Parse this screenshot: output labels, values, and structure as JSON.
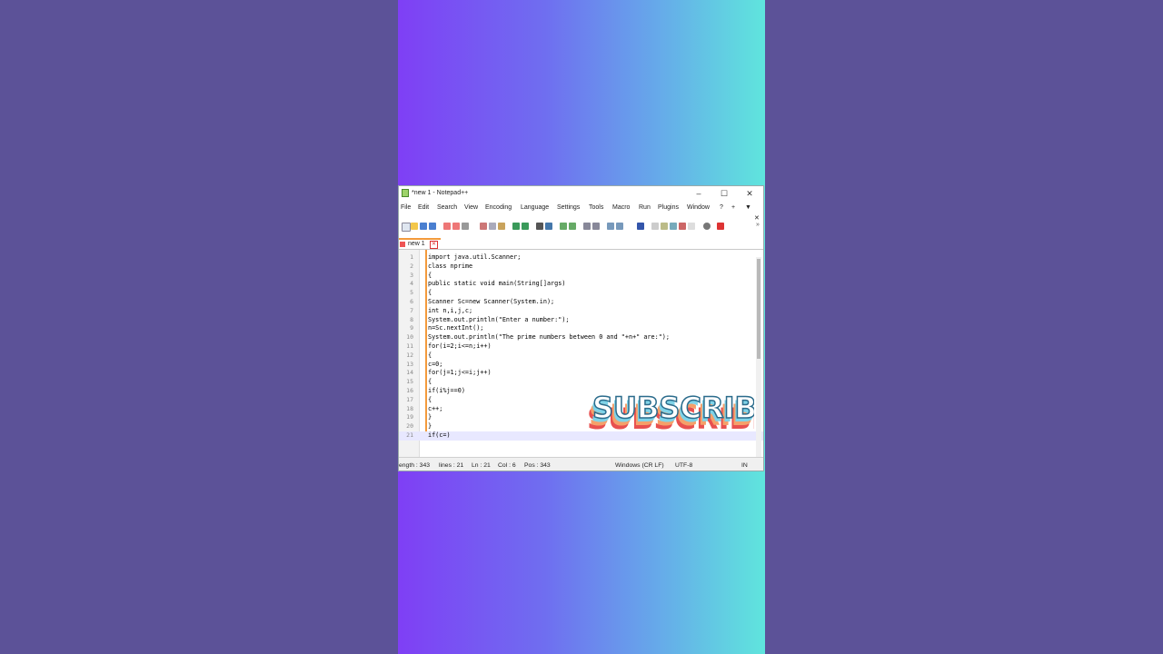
{
  "window": {
    "title": "*new 1 - Notepad++"
  },
  "menu": [
    "File",
    "Edit",
    "Search",
    "View",
    "Encoding",
    "Language",
    "Settings",
    "Tools",
    "Macro",
    "Run",
    "Plugins",
    "Window",
    "?",
    "+",
    "▼"
  ],
  "tab": {
    "label": "new 1"
  },
  "code_lines": [
    "import java.util.Scanner;",
    "class nprime",
    "{",
    "public static void main(String[]args)",
    "{",
    "Scanner Sc=new Scanner(System.in);",
    "int n,i,j,c;",
    "System.out.println(\"Enter a number:\");",
    "n=Sc.nextInt();",
    "System.out.println(\"The prime numbers between 0 and \"+n+\" are:\");",
    "for(i=2;i<=n;i++)",
    "{",
    "c=0;",
    "for(j=1;j<=i;j++)",
    "{",
    "if(i%j==0)",
    "{",
    "c++;",
    "}",
    "}",
    "if(c=)"
  ],
  "line_numbers": [
    "1",
    "2",
    "3",
    "4",
    "5",
    "6",
    "7",
    "8",
    "9",
    "10",
    "11",
    "12",
    "13",
    "14",
    "15",
    "16",
    "17",
    "18",
    "19",
    "20",
    "21"
  ],
  "status": {
    "length": "ength : 343",
    "lines": "lines : 21",
    "ln": "Ln : 21",
    "col": "Col : 6",
    "pos": "Pos : 343",
    "eol": "Windows (CR LF)",
    "encoding": "UTF-8",
    "mode": "IN"
  },
  "overlay": {
    "text": "SUBSCRIBE"
  },
  "colors": {
    "accent": "#f39a3c",
    "gradient_left": "#7f3ff5",
    "gradient_right": "#5fe5dd",
    "side_bg": "#5c5298"
  }
}
